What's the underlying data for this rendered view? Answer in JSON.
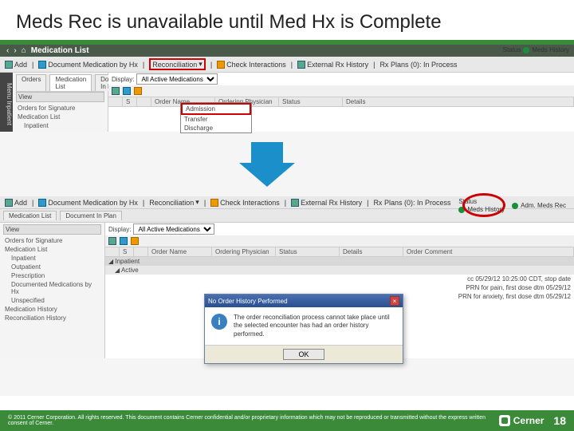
{
  "slide": {
    "title": "Meds Rec is unavailable until Med Hx is Complete"
  },
  "top_dark": {
    "title": "Medication List"
  },
  "toolbar_top": {
    "add": "Add",
    "doc_hx": "Document Medication by Hx",
    "reconcile": "Reconciliation",
    "check": "Check Interactions",
    "ext_rx": "External Rx History",
    "rx_plans": "Rx Plans (0): In Process"
  },
  "tabs_upper": {
    "med_list": "Medication List",
    "doc_in": "Document In Plan"
  },
  "left_upper": {
    "view_hdr": "View",
    "orders_sig": "Orders for Signature",
    "med_list": "Medication List",
    "inpatient": "Inpatient"
  },
  "status": {
    "label": "Status",
    "meds_history": "Meds History",
    "adm_meds": "Adm. Meds Rec"
  },
  "menu": {
    "admission": "Admission",
    "transfer": "Transfer",
    "discharge": "Discharge"
  },
  "display_filter": {
    "label": "Display:",
    "value": "All Active Medications"
  },
  "grid_cols": {
    "s": "S",
    "order_name": "Order Name",
    "status_col": "Status",
    "ordering_phys": "Ordering Physician",
    "details": "Details",
    "order_comment": "Order Comment"
  },
  "grid_groups": {
    "inpatient": "Inpatient",
    "active": "Active"
  },
  "left_lower": {
    "view_hdr": "View",
    "orders_sig": "Orders for Signature",
    "med_list": "Medication List",
    "inpatient": "Inpatient",
    "outpatient": "Outpatient",
    "prescription": "Prescription",
    "doc_hx": "Documented Medications by Hx",
    "unspecified": "Unspecified",
    "med_history": "Medication History",
    "recon_history": "Reconciliation History"
  },
  "grid_rows": {
    "r1": "cc 05/29/12 10:25:00 CDT, stop date",
    "r2": "PRN for pain, first dose dtm 05/29/12",
    "r3": "PRN for anxiety, first dose dtm 05/29/12"
  },
  "dialog": {
    "title": "No Order History Performed",
    "message": "The order reconciliation process cannot take place until the selected encounter has had an order history performed.",
    "ok": "OK"
  },
  "footer": {
    "copyright": "© 2011 Cerner Corporation. All rights reserved. This document contains Cerner confidential and/or proprietary information which may not be reproduced or transmitted without the express written consent of Cerner.",
    "page": "18",
    "brand": "Cerner"
  },
  "side_tab": "Menu   Inpatient"
}
